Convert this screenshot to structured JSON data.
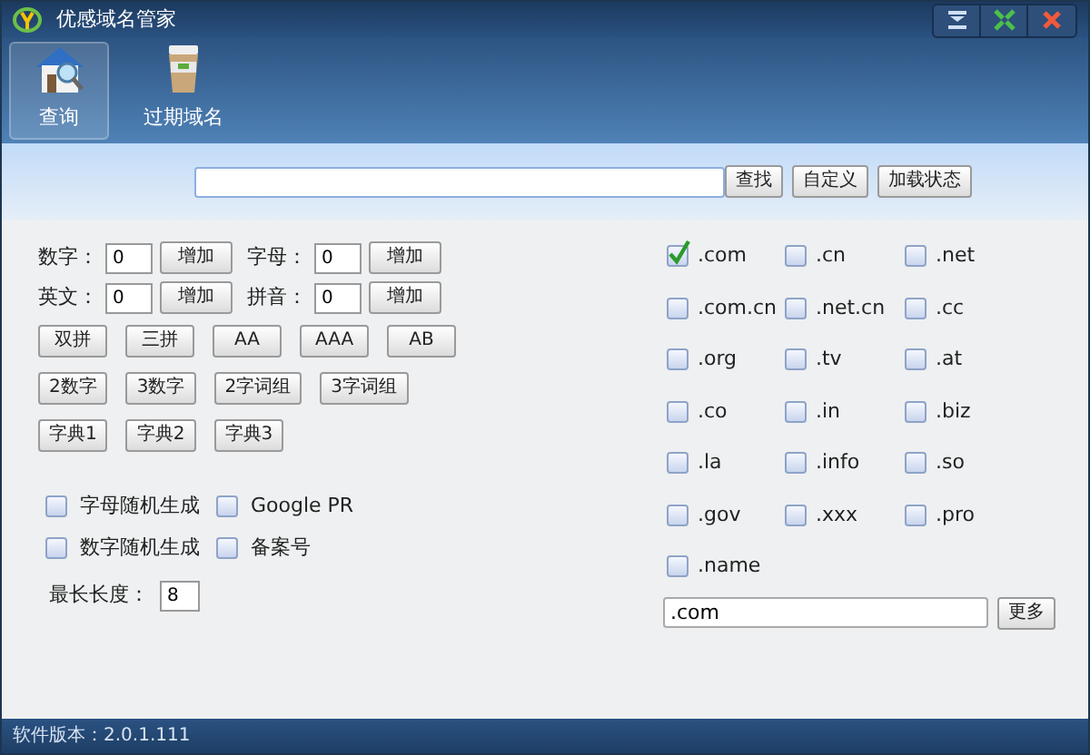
{
  "window": {
    "title": "优感域名管家"
  },
  "toolbar": [
    {
      "label": "查询",
      "selected": true
    },
    {
      "label": "过期域名",
      "selected": false
    }
  ],
  "search": {
    "buttons": [
      "查找",
      "自定义",
      "加载状态"
    ]
  },
  "counters": [
    {
      "label": "数字：",
      "value": "0",
      "button": "增加"
    },
    {
      "label": "字母：",
      "value": "0",
      "button": "增加"
    },
    {
      "label": "英文：",
      "value": "0",
      "button": "增加"
    },
    {
      "label": "拼音：",
      "value": "0",
      "button": "增加"
    }
  ],
  "pattern_buttons": [
    [
      "双拼",
      "三拼",
      "AA",
      "AAA",
      "AB"
    ],
    [
      "2数字",
      "3数字",
      "2字词组",
      "3字词组"
    ],
    [
      "字典1",
      "字典2",
      "字典3"
    ]
  ],
  "options": [
    {
      "label": "字母随机生成",
      "checked": false
    },
    {
      "label": "Google PR",
      "checked": false
    },
    {
      "label": "数字随机生成",
      "checked": false
    },
    {
      "label": "备案号",
      "checked": false
    }
  ],
  "max_length": {
    "label": "最长长度：",
    "value": "8"
  },
  "tlds": [
    {
      "label": ".com",
      "checked": true
    },
    {
      "label": ".cn",
      "checked": false
    },
    {
      "label": ".net",
      "checked": false
    },
    {
      "label": ".com.cn",
      "checked": false
    },
    {
      "label": ".net.cn",
      "checked": false
    },
    {
      "label": ".cc",
      "checked": false
    },
    {
      "label": ".org",
      "checked": false
    },
    {
      "label": ".tv",
      "checked": false
    },
    {
      "label": ".at",
      "checked": false
    },
    {
      "label": ".co",
      "checked": false
    },
    {
      "label": ".in",
      "checked": false
    },
    {
      "label": ".biz",
      "checked": false
    },
    {
      "label": ".la",
      "checked": false
    },
    {
      "label": ".info",
      "checked": false
    },
    {
      "label": ".so",
      "checked": false
    },
    {
      "label": ".gov",
      "checked": false
    },
    {
      "label": ".xxx",
      "checked": false
    },
    {
      "label": ".pro",
      "checked": false
    },
    {
      "label": ".name",
      "checked": false
    }
  ],
  "tld_field": {
    "value": ".com",
    "button": "更多"
  },
  "status_bar": "软件版本：2.0.1.111"
}
